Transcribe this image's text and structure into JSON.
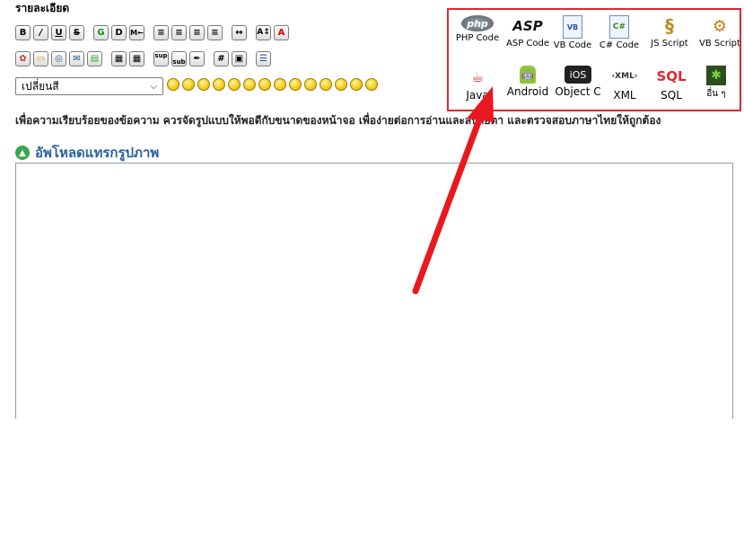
{
  "form": {
    "section_title": "รายละเอียด",
    "notice": "เพื่อความเรียบร้อยของข้อความ ควรจัดรูปแบบให้พอดีกับขนาดของหน้าจอ เพื่อง่ายต่อการอ่านและสบายตา และตรวจสอบภาษาไทยให้ถูกต้อง",
    "upload_label": "อัพโหลดแทรกรูปภาพ",
    "color_select": {
      "selected": "เปลี่ยนสี",
      "arrow": "⌵"
    }
  },
  "toolbar": {
    "row1": [
      {
        "name": "bold-button",
        "glyph": "B"
      },
      {
        "name": "italic-button",
        "glyph": "/"
      },
      {
        "name": "underline-button",
        "glyph": "U"
      },
      {
        "name": "strikethrough-button",
        "glyph": "S"
      },
      {
        "name": "glow-button",
        "glyph": "G"
      },
      {
        "name": "shadow-button",
        "glyph": "D"
      },
      {
        "name": "move-button",
        "glyph": "M←"
      },
      {
        "name": "align-left-button",
        "glyph": "≡"
      },
      {
        "name": "align-center-button",
        "glyph": "≡"
      },
      {
        "name": "align-justify-button",
        "glyph": "≡"
      },
      {
        "name": "align-right-button",
        "glyph": "≡"
      },
      {
        "name": "horizontal-rule-button",
        "glyph": "↔"
      },
      {
        "name": "font-size-button",
        "glyph": "A↕"
      },
      {
        "name": "font-color-button",
        "glyph": "A"
      }
    ],
    "row2": [
      {
        "name": "flash-button",
        "glyph": "✿"
      },
      {
        "name": "image-button",
        "glyph": "▭"
      },
      {
        "name": "hyperlink-button",
        "glyph": "◎"
      },
      {
        "name": "email-button",
        "glyph": "✉"
      },
      {
        "name": "ftp-button",
        "glyph": "▤"
      },
      {
        "name": "table-button",
        "glyph": "▦"
      },
      {
        "name": "table-insert-button",
        "glyph": "▦"
      },
      {
        "name": "superscript-button",
        "glyph": "sup"
      },
      {
        "name": "subscript-button",
        "glyph": "sub"
      },
      {
        "name": "teletype-button",
        "glyph": "✒"
      },
      {
        "name": "code-button",
        "glyph": "#"
      },
      {
        "name": "quote-button",
        "glyph": "▣"
      },
      {
        "name": "list-button",
        "glyph": "☰"
      }
    ],
    "smiley_count": 14
  },
  "code_panel": {
    "items": [
      {
        "label": "PHP Code",
        "icon": "php-icon",
        "symbol": "php"
      },
      {
        "label": "ASP Code",
        "icon": "asp-icon",
        "symbol": "ASP"
      },
      {
        "label": "VB Code",
        "icon": "vb-doc-icon",
        "symbol": "VB"
      },
      {
        "label": "C# Code",
        "icon": "csharp-doc-icon",
        "symbol": "C#"
      },
      {
        "label": "JS Script",
        "icon": "js-script-icon",
        "symbol": "§"
      },
      {
        "label": "VB Script",
        "icon": "vb-script-icon",
        "symbol": "⚙"
      },
      {
        "label": "Java",
        "icon": "java-icon",
        "symbol": "☕"
      },
      {
        "label": "Android",
        "icon": "android-icon",
        "symbol": "🤖"
      },
      {
        "label": "Object C",
        "icon": "ios-icon",
        "symbol": "iOS"
      },
      {
        "label": "XML",
        "icon": "xml-icon",
        "symbol": "‹XML›"
      },
      {
        "label": "SQL",
        "icon": "sql-icon",
        "symbol": "SQL"
      },
      {
        "label": "อื่น ๆ",
        "icon": "other-code-icon",
        "symbol": "✱"
      }
    ]
  },
  "colors": {
    "highlight_border": "#e0282e",
    "arrow": "#e8191e",
    "upload_text": "#2b5f9e"
  }
}
